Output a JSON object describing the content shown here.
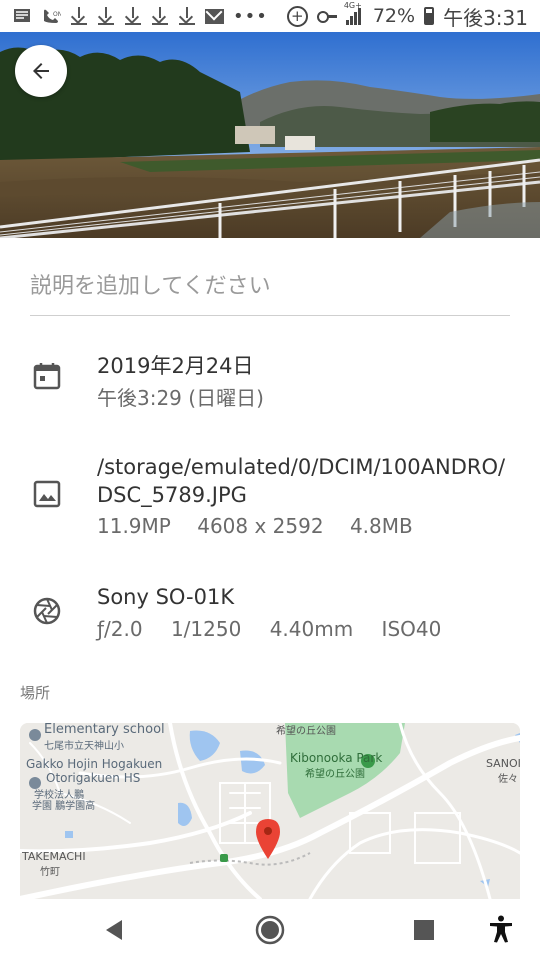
{
  "status_bar": {
    "battery": "72%",
    "time": "午後3:31",
    "network": "4G+"
  },
  "description_placeholder": "説明を追加してください",
  "date_info": {
    "date": "2019年2月24日",
    "time": "午後3:29 (日曜日)"
  },
  "file_info": {
    "path_line1": "/storage/emulated/0/DCIM/100ANDRO/",
    "path_line2": "DSC_5789.JPG",
    "megapixels": "11.9MP",
    "resolution": "4608 x 2592",
    "size": "4.8MB"
  },
  "camera_info": {
    "model": "Sony SO-01K",
    "aperture": "ƒ/2.0",
    "shutter": "1/1250",
    "focal_length": "4.40mm",
    "iso": "ISO40"
  },
  "location_label": "場所",
  "map": {
    "labels": {
      "school_en": "Elementary school",
      "school_jp": "七尾市立天神山小",
      "gakko_en1": "Gakko Hojin Hogakuen",
      "gakko_en2": "Otorigakuen HS",
      "gakko_jp1": "学校法人鵬",
      "gakko_jp2": "学園 鵬学園高",
      "kibou_top": "希望の丘公園",
      "park_en": "Kibonooka Park",
      "park_jp": "希望の丘公園",
      "sanoi_en": "SANOI",
      "sanoi_jp": "佐々",
      "takemachi_en": "TAKEMACHI",
      "takemachi_jp": "竹町"
    },
    "colors": {
      "park": "#a8dab0",
      "water": "#9fc5f0",
      "marker": "#ea4335"
    }
  }
}
